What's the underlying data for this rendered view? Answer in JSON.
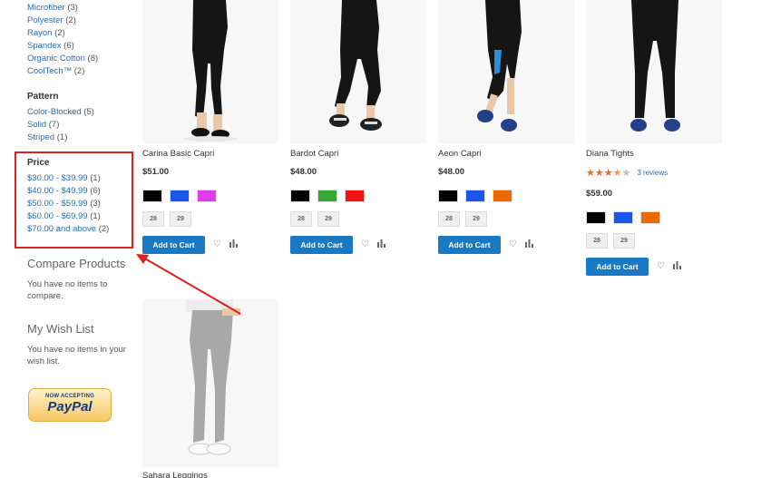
{
  "sidebar": {
    "material": [
      {
        "label": "Microfiber",
        "count": "(3)"
      },
      {
        "label": "Polyester",
        "count": "(2)"
      },
      {
        "label": "Rayon",
        "count": "(2)"
      },
      {
        "label": "Spandex",
        "count": "(6)"
      },
      {
        "label": "Organic Cotton",
        "count": "(8)"
      },
      {
        "label": "CoolTech™",
        "count": "(2)"
      }
    ],
    "pattern_title": "Pattern",
    "pattern": [
      {
        "label": "Color-Blocked",
        "count": "(5)"
      },
      {
        "label": "Solid",
        "count": "(7)"
      },
      {
        "label": "Striped",
        "count": "(1)"
      }
    ],
    "price_title": "Price",
    "price": [
      {
        "label": "$30.00 - $39.99",
        "count": "(1)"
      },
      {
        "label": "$40.00 - $49.99",
        "count": "(6)"
      },
      {
        "label": "$50.00 - $59.99",
        "count": "(3)"
      },
      {
        "label": "$60.00 - $69.99",
        "count": "(1)"
      },
      {
        "label": "$70.00 and above",
        "count": "(2)"
      }
    ],
    "compare_title": "Compare Products",
    "compare_text": "You have no items to compare.",
    "wishlist_title": "My Wish List",
    "wishlist_text": "You have no items in your wish list.",
    "paypal_top": "NOW ACCEPTING",
    "paypal_brand": "PayPal"
  },
  "cart_label": "Add to Cart",
  "products": [
    {
      "name": "Carina Basic Capri",
      "price": "$51.00",
      "colors": [
        "#000000",
        "#1a56e8",
        "#e03ce8"
      ],
      "sizes": [
        "28",
        "29"
      ]
    },
    {
      "name": "Bardot Capri",
      "price": "$48.00",
      "colors": [
        "#000000",
        "#3aa636",
        "#ef1313"
      ],
      "sizes": [
        "28",
        "29"
      ]
    },
    {
      "name": "Aeon Capri",
      "price": "$48.00",
      "colors": [
        "#000000",
        "#1a56e8",
        "#ec6a06"
      ],
      "sizes": [
        "28",
        "29"
      ]
    },
    {
      "name": "Diana Tights",
      "price": "$59.00",
      "rating_stars": 3.5,
      "reviews": "3 reviews",
      "colors": [
        "#000000",
        "#1a56e8",
        "#ec6a06"
      ],
      "sizes": [
        "28",
        "29"
      ]
    },
    {
      "name": "Sahara Leggings"
    }
  ],
  "icons": {
    "wishlist": "heart-icon",
    "compare": "bar-chart-icon"
  },
  "colors": {
    "accent": "#1979c3",
    "link": "#2d6ea8",
    "highlight": "#e02020",
    "star": "#f26422"
  }
}
